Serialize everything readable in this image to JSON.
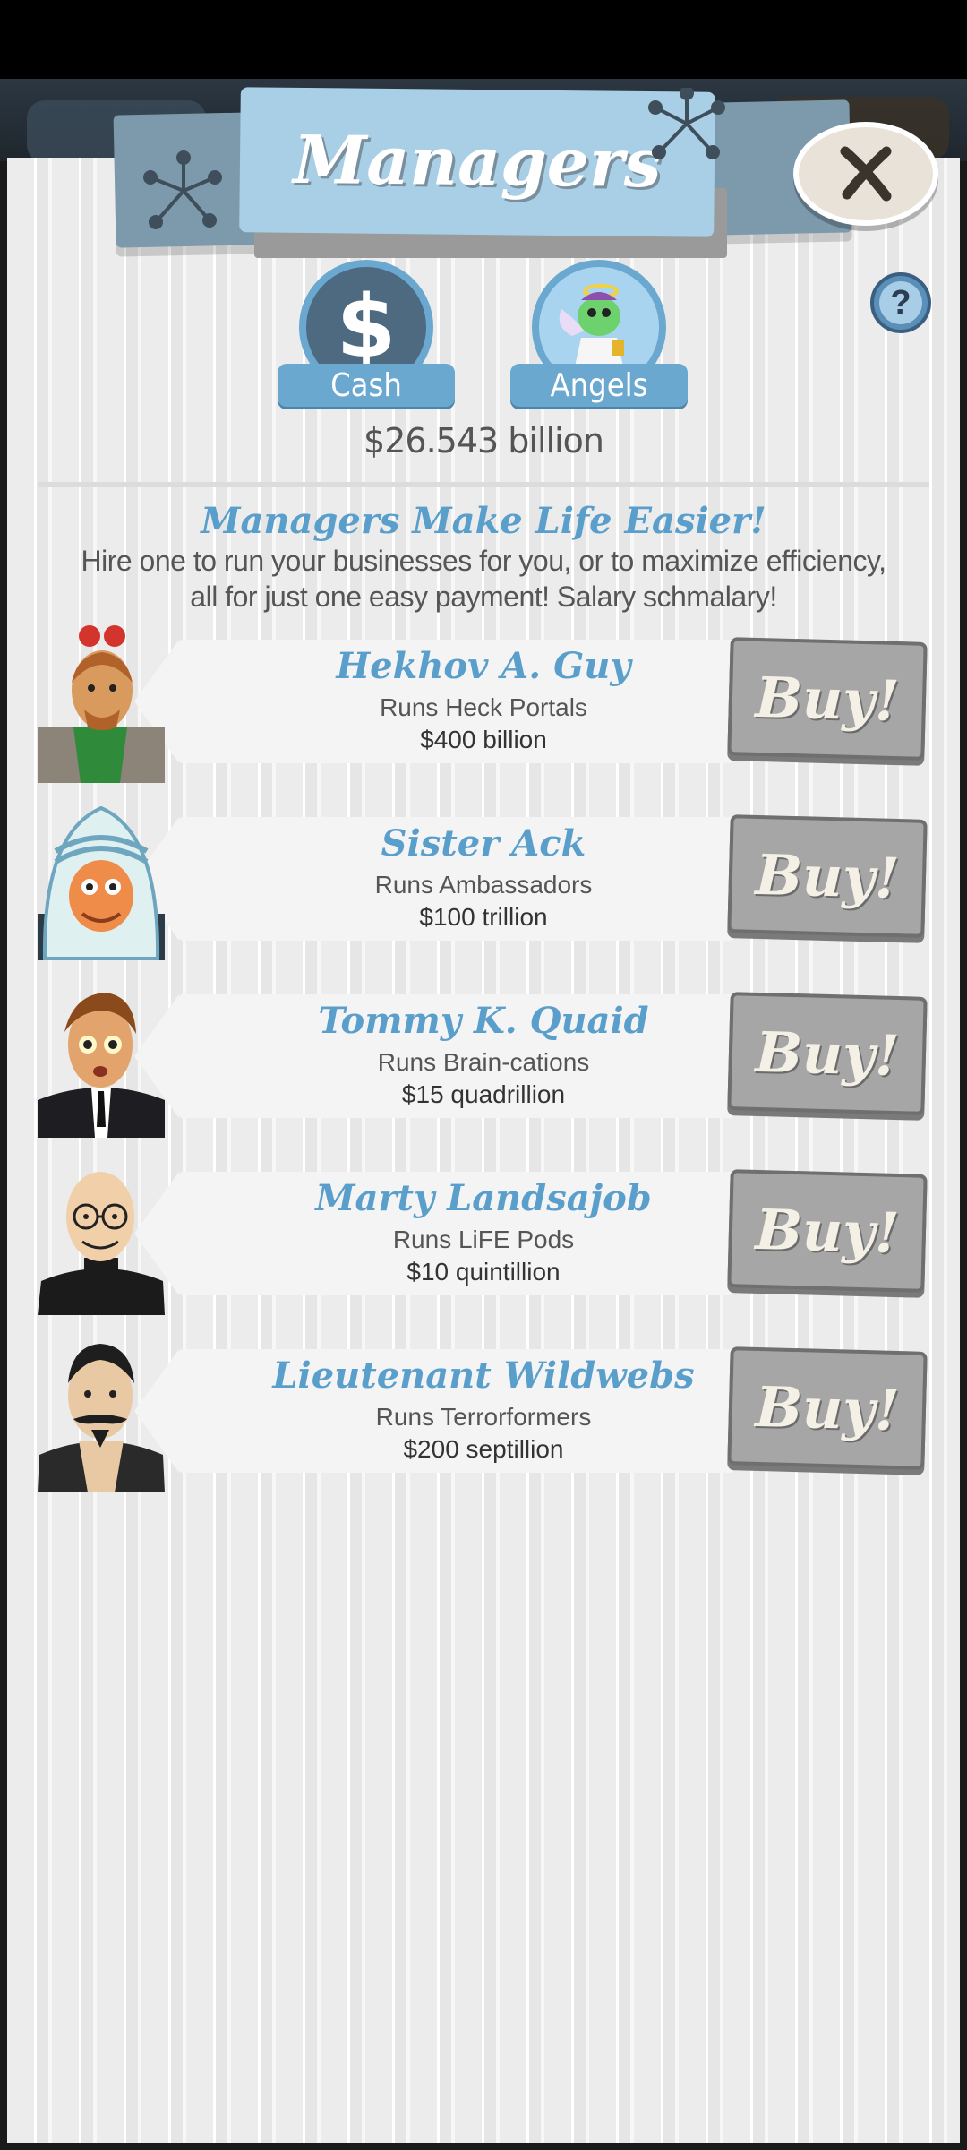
{
  "header": {
    "title": "Managers",
    "close_label": "X",
    "help_label": "?"
  },
  "currency": {
    "cash": {
      "label": "Cash",
      "symbol": "$"
    },
    "angels": {
      "label": "Angels"
    },
    "total": "$26.543 billion"
  },
  "intro": {
    "headline": "Managers Make Life Easier!",
    "text": "Hire one to run your businesses for you, or to maximize efficiency, all for just one easy payment! Salary schmalary!"
  },
  "managers": [
    {
      "name": "Hekhov A. Guy",
      "runs": "Runs Heck Portals",
      "cost": "$400 billion",
      "buy_label": "Buy!"
    },
    {
      "name": "Sister Ack",
      "runs": "Runs Ambassadors",
      "cost": "$100 trillion",
      "buy_label": "Buy!"
    },
    {
      "name": "Tommy K. Quaid",
      "runs": "Runs Brain-cations",
      "cost": "$15 quadrillion",
      "buy_label": "Buy!"
    },
    {
      "name": "Marty Landsajob",
      "runs": "Runs LiFE Pods",
      "cost": "$10 quintillion",
      "buy_label": "Buy!"
    },
    {
      "name": "Lieutenant Wildwebs",
      "runs": "Runs Terrorformers",
      "cost": "$200 septillion",
      "buy_label": "Buy!"
    }
  ],
  "colors": {
    "accent": "#5a9fcb",
    "button": "#a6a6a6",
    "banner": "#a9cfe6"
  }
}
